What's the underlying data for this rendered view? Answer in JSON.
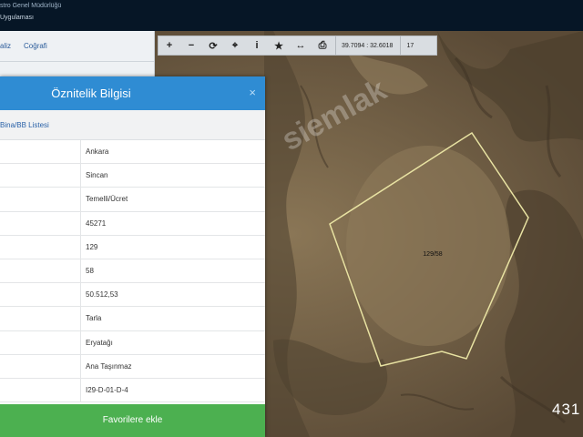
{
  "header": {
    "line1": "stro Genel Müdürlüğü",
    "line2": "Uygulaması"
  },
  "sidebar": {
    "tabs": [
      {
        "label": "aliz"
      },
      {
        "label": "Coğrafi"
      }
    ]
  },
  "toolbar": {
    "tools": [
      {
        "icon": "zoom-in-icon",
        "glyph": "+"
      },
      {
        "icon": "zoom-out-icon",
        "glyph": "−"
      },
      {
        "icon": "refresh-icon",
        "glyph": "⟳"
      },
      {
        "icon": "locate-icon",
        "glyph": "⌖"
      },
      {
        "icon": "info-icon",
        "glyph": "i"
      },
      {
        "icon": "star-icon",
        "glyph": "★"
      },
      {
        "icon": "measure-icon",
        "glyph": "↔"
      },
      {
        "icon": "print-icon",
        "glyph": "⎙"
      }
    ],
    "coordinates": "39.7094 : 32.6018",
    "zoom": "17"
  },
  "popup": {
    "title": "Öznitelik Bilgisi",
    "close_glyph": "×",
    "sublink": "Bina/BB Listesi",
    "rows": [
      {
        "value": "Ankara"
      },
      {
        "value": "Sincan"
      },
      {
        "value": "Temelli/Ücret"
      },
      {
        "value": "45271"
      },
      {
        "value": "129"
      },
      {
        "value": "58"
      },
      {
        "value": "50.512,53"
      },
      {
        "value": "Tarla"
      },
      {
        "value": "Eryatağı"
      },
      {
        "value": "Ana Taşınmaz"
      },
      {
        "value": "I29-D-01-D-4"
      }
    ],
    "button_label": "Favorilere ekle"
  },
  "map": {
    "parcel_label": "129/58",
    "tile_number": "431",
    "watermark": "siemlak",
    "parcel_outline_color": "#e8e2a2"
  }
}
